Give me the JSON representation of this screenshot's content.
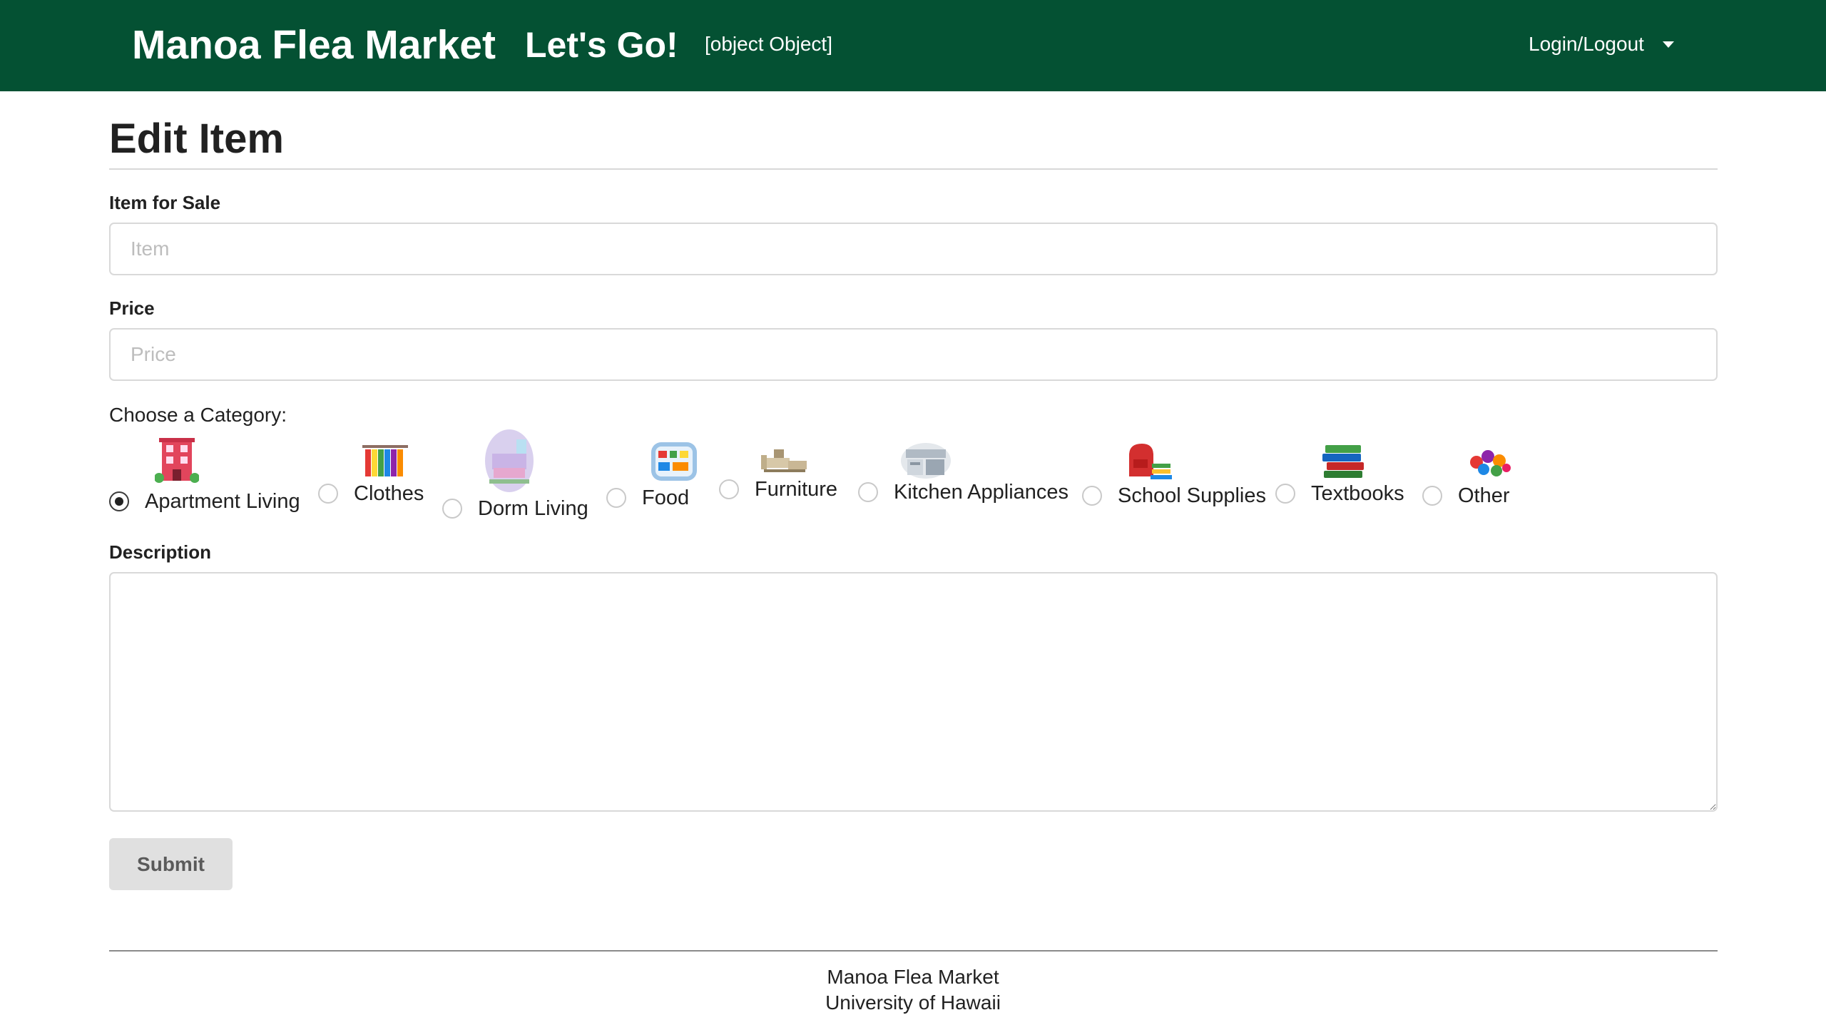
{
  "navbar": {
    "brand": "Manoa Flea Market",
    "lets_go": "Let's Go!",
    "object_text": "[object Object]",
    "login_menu": "Login/Logout",
    "background_color": "#045133"
  },
  "page": {
    "title": "Edit Item"
  },
  "form": {
    "item": {
      "label": "Item for Sale",
      "placeholder": "Item",
      "value": ""
    },
    "price": {
      "label": "Price",
      "placeholder": "Price",
      "value": ""
    },
    "category": {
      "label": "Choose a Category:",
      "selected": "Apartment Living",
      "options": [
        {
          "label": "Apartment Living",
          "icon": "apartment-building-icon"
        },
        {
          "label": "Clothes",
          "icon": "clothes-rack-icon"
        },
        {
          "label": "Dorm Living",
          "icon": "dorm-room-icon"
        },
        {
          "label": "Food",
          "icon": "refrigerator-food-icon"
        },
        {
          "label": "Furniture",
          "icon": "furniture-icon"
        },
        {
          "label": "Kitchen Appliances",
          "icon": "kitchen-icon"
        },
        {
          "label": "School Supplies",
          "icon": "school-supplies-icon"
        },
        {
          "label": "Textbooks",
          "icon": "textbooks-stack-icon"
        },
        {
          "label": "Other",
          "icon": "other-items-icon"
        }
      ]
    },
    "description": {
      "label": "Description",
      "value": ""
    },
    "submit_label": "Submit"
  },
  "footer": {
    "line1": "Manoa Flea Market",
    "line2": "University of Hawaii"
  }
}
